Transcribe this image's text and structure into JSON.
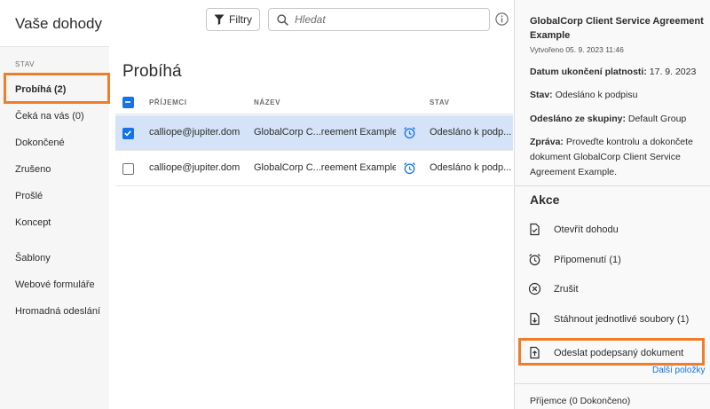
{
  "header": {
    "title": "Vaše dohody",
    "filter_label": "Filtry",
    "search_placeholder": "Hledat"
  },
  "sidebar": {
    "section_label": "STAV",
    "items": [
      {
        "label": "Probíhá (2)",
        "active": true
      },
      {
        "label": "Čeká na vás (0)"
      },
      {
        "label": "Dokončené"
      },
      {
        "label": "Zrušeno"
      },
      {
        "label": "Prošlé"
      },
      {
        "label": "Koncept"
      },
      {
        "label": "Šablony"
      },
      {
        "label": "Webové formuláře"
      },
      {
        "label": "Hromadná odeslání"
      }
    ]
  },
  "main": {
    "title": "Probíhá",
    "columns": [
      "PŘÍJEMCI",
      "NÁZEV",
      "STAV"
    ],
    "rows": [
      {
        "recipient": "calliope@jupiter.dom",
        "name": "GlobalCorp C...reement Example",
        "status": "Odesláno k podp...",
        "selected": true
      },
      {
        "recipient": "calliope@jupiter.dom",
        "name": "GlobalCorp C...reement Example",
        "status": "Odesláno k podp...",
        "selected": false
      }
    ]
  },
  "panel": {
    "title": "GlobalCorp Client Service Agreement Example",
    "created": "Vytvořeno 05. 9. 2023 11:46",
    "fields": [
      {
        "label": "Datum ukončení platnosti:",
        "value": "17. 9. 2023"
      },
      {
        "label": "Stav:",
        "value": "Odesláno k podpisu"
      },
      {
        "label": "Odesláno ze skupiny:",
        "value": "Default Group"
      },
      {
        "label": "Zpráva:",
        "value": "Proveďte kontrolu a dokončete dokument GlobalCorp Client Service Agreement Example."
      }
    ],
    "actions_heading": "Akce",
    "actions": [
      {
        "label": "Otevřít dohodu",
        "icon": "document-check-icon"
      },
      {
        "label": "Připomenutí (1)",
        "icon": "alarm-clock-icon"
      },
      {
        "label": "Zrušit",
        "icon": "cancel-circle-icon"
      },
      {
        "label": "Stáhnout jednotlivé soubory (1)",
        "icon": "download-file-icon"
      },
      {
        "label": "Odeslat podepsaný dokument",
        "icon": "upload-file-icon"
      }
    ],
    "more_link": "Další položky",
    "recipients": "Příjemce (0 Dokončeno)"
  },
  "colors": {
    "accent": "#1473e6",
    "highlight": "#f07d2a",
    "selected_row": "#d4e3f7"
  }
}
